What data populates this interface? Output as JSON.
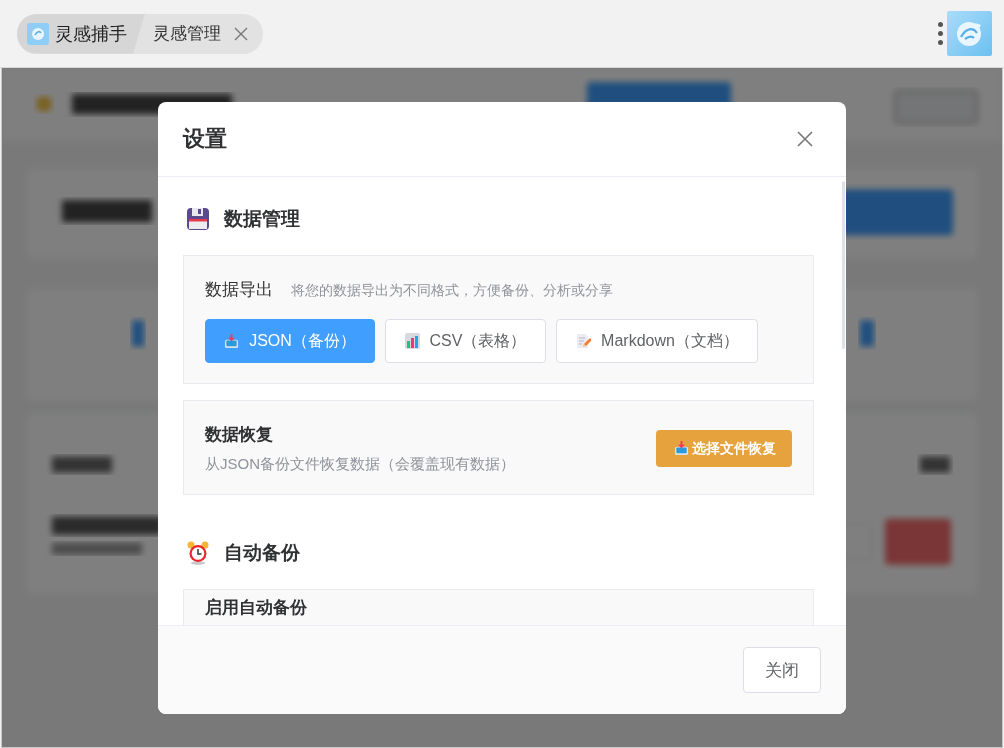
{
  "browser": {
    "tabs": [
      {
        "label": "灵感捕手",
        "selected": true,
        "closable": false
      },
      {
        "label": "灵感管理",
        "selected": false,
        "closable": true
      }
    ]
  },
  "dialog": {
    "title": "设置",
    "sections": [
      {
        "title": "数据管理",
        "cards": [
          {
            "kind": "export",
            "label": "数据导出",
            "description": "将您的数据导出为不同格式，方便备份、分析或分享",
            "buttons": [
              {
                "label": "JSON（备份）",
                "primary": true
              },
              {
                "label": "CSV（表格）",
                "primary": false
              },
              {
                "label": "Markdown（文档）",
                "primary": false
              }
            ]
          },
          {
            "kind": "restore",
            "title": "数据恢复",
            "description": "从JSON备份文件恢复数据（会覆盖现有数据）",
            "button": "选择文件恢复"
          }
        ]
      },
      {
        "title": "自动备份",
        "cards": [
          {
            "kind": "toggle",
            "title": "启用自动备份"
          }
        ]
      }
    ],
    "footer_button": "关闭"
  }
}
